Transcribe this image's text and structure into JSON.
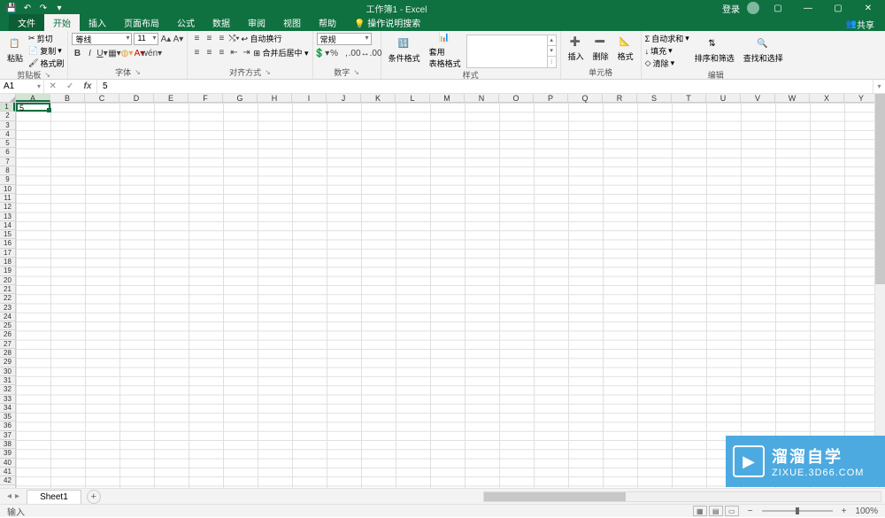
{
  "titlebar": {
    "title": "工作簿1 - Excel",
    "user": "登录"
  },
  "tabs": {
    "file": "文件",
    "home": "开始",
    "insert": "插入",
    "layout": "页面布局",
    "formulas": "公式",
    "data": "数据",
    "review": "审阅",
    "view": "视图",
    "help": "帮助",
    "tellme": "操作说明搜索",
    "share": "共享"
  },
  "ribbon": {
    "clipboard": {
      "label": "剪贴板",
      "paste": "粘贴",
      "cut": "剪切",
      "copy": "复制",
      "format": "格式刷"
    },
    "font": {
      "label": "字体",
      "name": "等线",
      "size": "11"
    },
    "align": {
      "label": "对齐方式",
      "wrap": "自动换行",
      "merge": "合并后居中"
    },
    "number": {
      "label": "数字",
      "format": "常规"
    },
    "cond": {
      "label": "条件格式"
    },
    "tablefmt": {
      "label": "套用\n表格格式"
    },
    "styles": {
      "label": "样式"
    },
    "cells": {
      "label": "单元格",
      "insert": "插入",
      "delete": "删除",
      "format": "格式"
    },
    "editing": {
      "label": "编辑",
      "sum": "自动求和",
      "fill": "填充",
      "clear": "清除",
      "sort": "排序和筛选",
      "find": "查找和选择"
    }
  },
  "fx": {
    "namebox": "A1",
    "formula": "5"
  },
  "grid": {
    "cols": [
      "A",
      "B",
      "C",
      "D",
      "E",
      "F",
      "G",
      "H",
      "I",
      "J",
      "K",
      "L",
      "M",
      "N",
      "O",
      "P",
      "Q",
      "R",
      "S",
      "T",
      "U",
      "V",
      "W",
      "X",
      "Y"
    ],
    "rows": 42,
    "active_value": "5"
  },
  "sheets": {
    "tab1": "Sheet1"
  },
  "status": {
    "left": "输入",
    "zoom": "100%"
  },
  "watermark": {
    "main": "溜溜自学",
    "sub": "ZIXUE.3D66.COM"
  }
}
